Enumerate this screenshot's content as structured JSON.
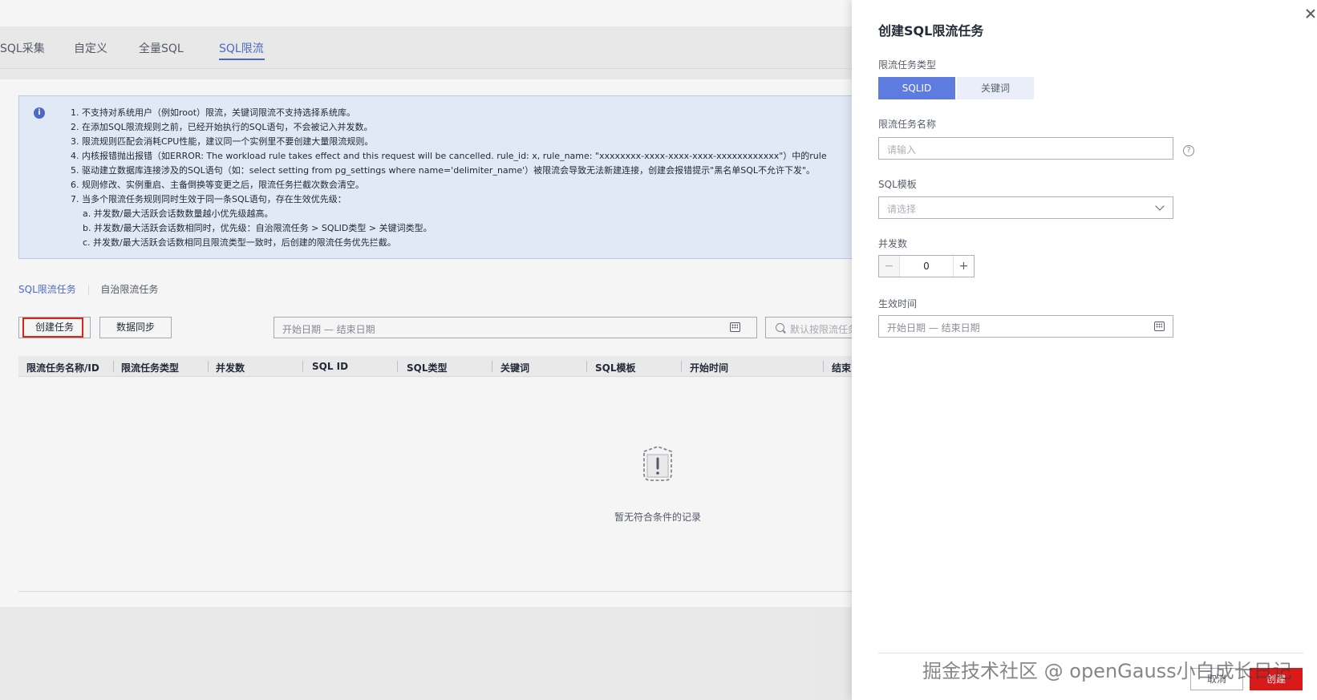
{
  "tabs": [
    {
      "label": "SQL采集",
      "active": false
    },
    {
      "label": "自定义",
      "active": false
    },
    {
      "label": "全量SQL",
      "active": false
    },
    {
      "label": "SQL限流",
      "active": true
    }
  ],
  "notice": {
    "icon": "info-icon",
    "lines": [
      "1. 不支持对系统用户（例如root）限流，关键词限流不支持选择系统库。",
      "2. 在添加SQL限流规则之前，已经开始执行的SQL语句，不会被记入并发数。",
      "3. 限流规则匹配会消耗CPU性能，建议同一个实例里不要创建大量限流规则。",
      "4. 内核报错抛出报错（如ERROR: The workload rule takes effect and this request will be cancelled. rule_id: x, rule_name: \"xxxxxxxx-xxxx-xxxx-xxxx-xxxxxxxxxxxx\"）中的rule",
      "5. 驱动建立数据库连接涉及的SQL语句（如：select setting from pg_settings where name='delimiter_name'）被限流会导致无法新建连接，创建会报错提示\"黑名单SQL不允许下发\"。",
      "6. 规则修改、实例重启、主备倒换等变更之后，限流任务拦截次数会清空。",
      "7. 当多个限流任务规则同时生效于同一条SQL语句，存在生效优先级："
    ],
    "sub_lines": [
      "a. 并发数/最大活跃会话数数量越小优先级越高。",
      "b. 并发数/最大活跃会话数相同时，优先级：自治限流任务 > SQLID类型 > 关键词类型。",
      "c. 并发数/最大活跃会话数相同且限流类型一致时，后创建的限流任务优先拦截。"
    ]
  },
  "subtabs": [
    {
      "label": "SQL限流任务",
      "active": true
    },
    {
      "label": "自治限流任务",
      "active": false
    }
  ],
  "toolbar": {
    "create_label": "创建任务",
    "sync_label": "数据同步",
    "date_placeholder": "开始日期 — 结束日期",
    "search_placeholder": "默认按限流任务"
  },
  "table": {
    "columns": [
      "限流任务名称/ID",
      "限流任务类型",
      "并发数",
      "SQL ID",
      "SQL类型",
      "关键词",
      "SQL模板",
      "开始时间",
      "结束"
    ],
    "empty_text": "暂无符合条件的记录"
  },
  "drawer": {
    "title": "创建SQL限流任务",
    "type_label": "限流任务类型",
    "type_options": [
      {
        "label": "SQLID",
        "selected": true
      },
      {
        "label": "关键词",
        "selected": false
      }
    ],
    "name_label": "限流任务名称",
    "name_placeholder": "请输入",
    "template_label": "SQL模板",
    "template_placeholder": "请选择",
    "concurrency_label": "并发数",
    "concurrency_value": "0",
    "minus": "−",
    "plus": "+",
    "time_label": "生效时间",
    "time_placeholder": "开始日期 — 结束日期",
    "cancel_label": "取消",
    "submit_label": "创建"
  },
  "watermark": "掘金技术社区 @ openGauss小白成长日记",
  "colors": {
    "accent": "#526ecc",
    "segment_selected": "#5e7ce0",
    "highlight_box": "#e8251b",
    "submit": "#d91a1a",
    "notice_bg": "#eaf3ff"
  }
}
